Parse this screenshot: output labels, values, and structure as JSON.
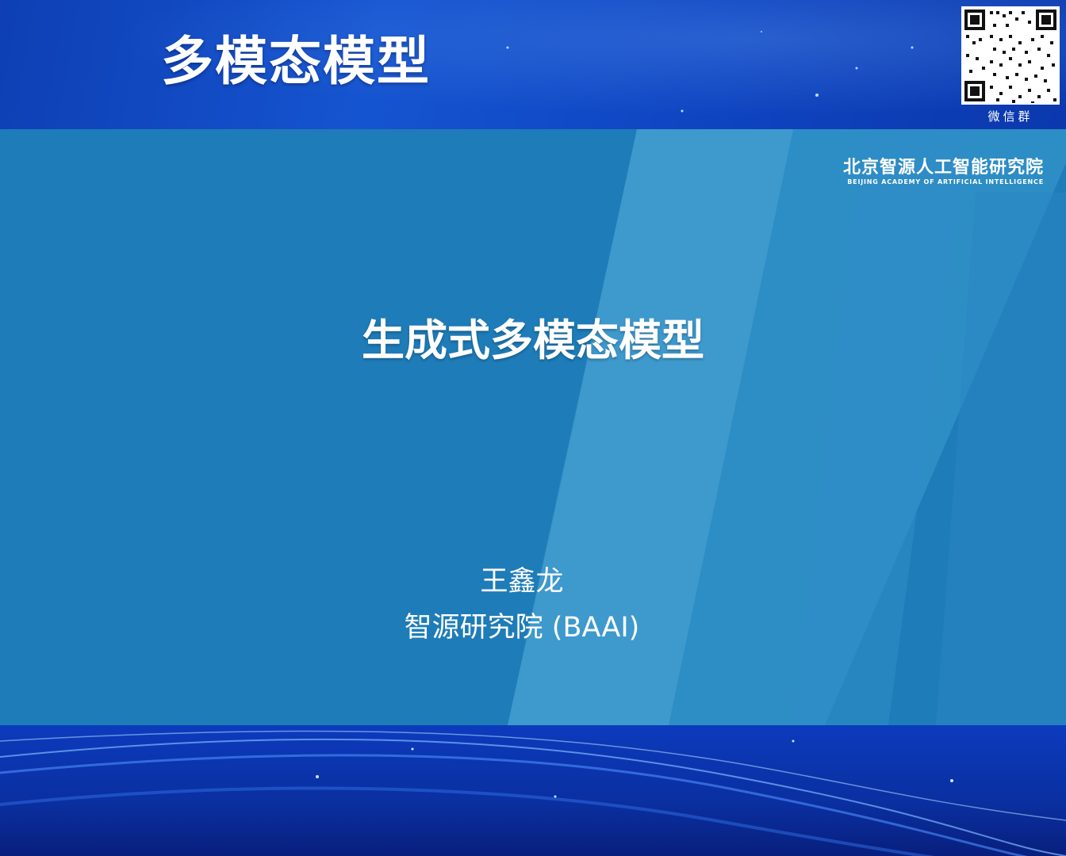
{
  "header": {
    "session_title": "多模态模型",
    "qr_caption": "微信群"
  },
  "logo": {
    "name_cn": "北京智源人工智能研究院",
    "name_en": "BEIJING ACADEMY OF ARTIFICIAL INTELLIGENCE"
  },
  "slide": {
    "title": "生成式多模态模型",
    "author": "王鑫龙",
    "affiliation": "智源研究院 (BAAI)"
  },
  "colors": {
    "banner_blue": "#1554d0",
    "slide_blue": "#1e7cb8",
    "text": "#ffffff"
  }
}
